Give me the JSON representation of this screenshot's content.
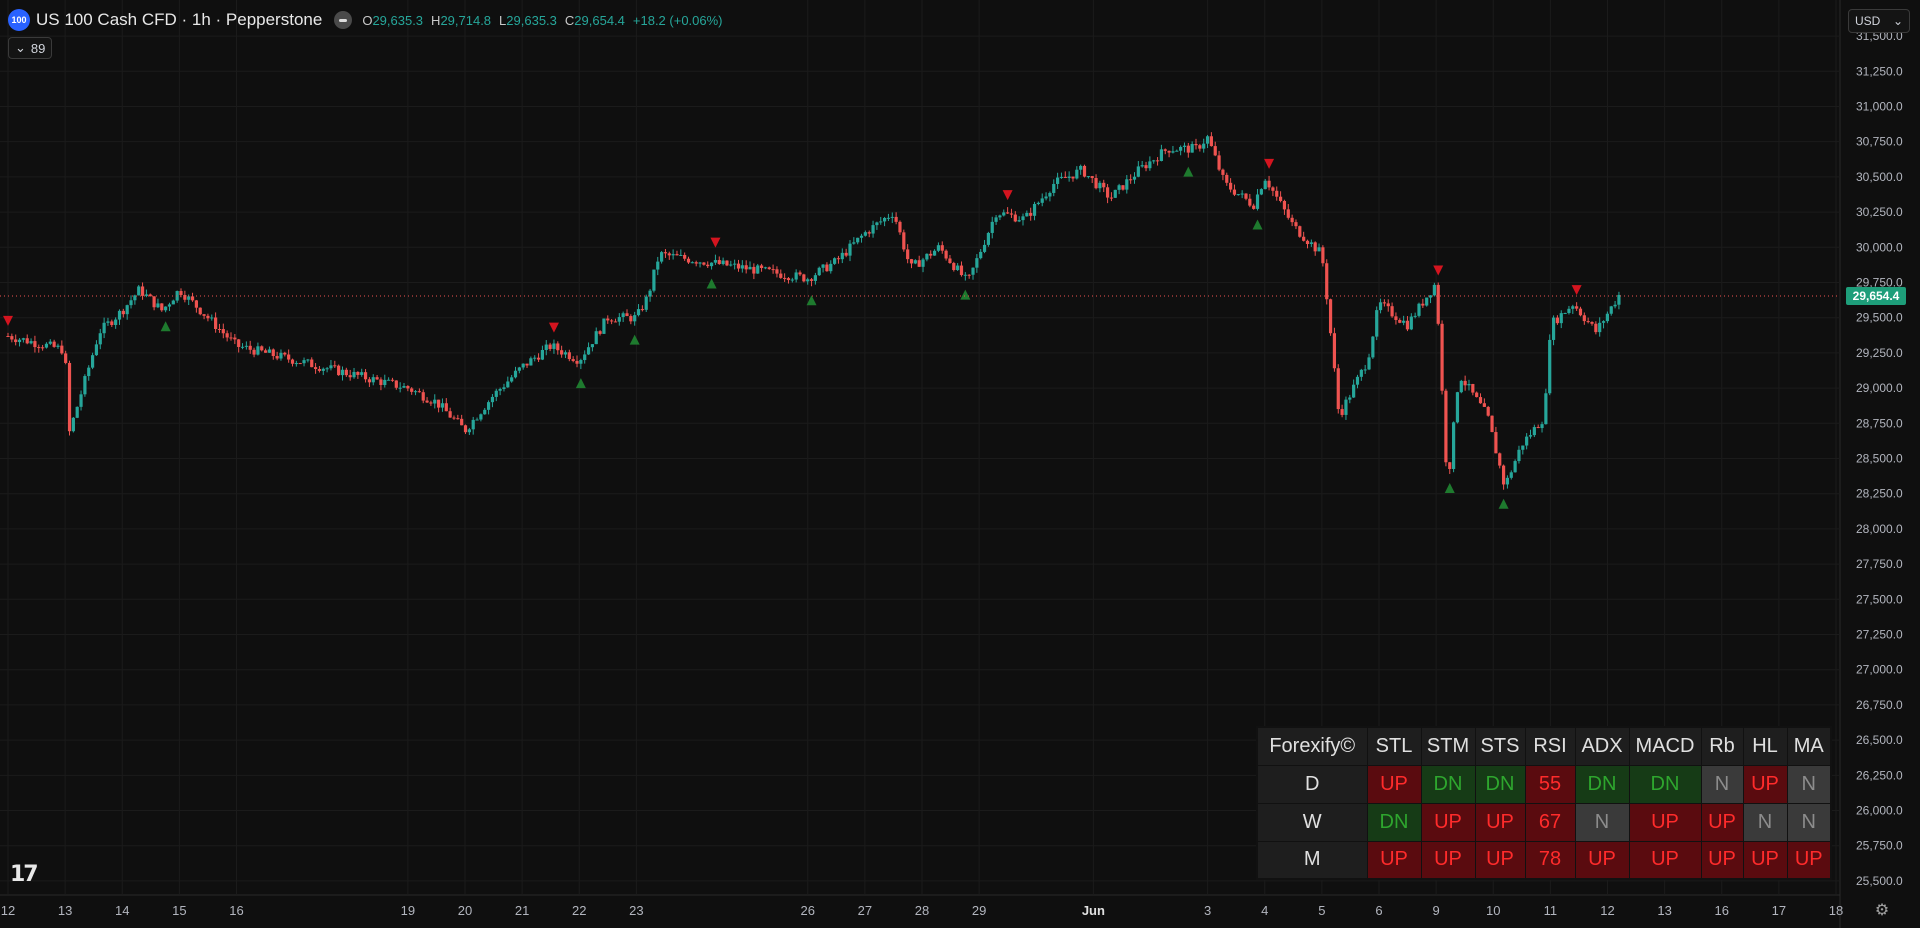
{
  "header": {
    "logo_text": "100",
    "title": "US 100 Cash CFD · 1h · Pepperstone",
    "ohlc": [
      {
        "label": "O",
        "value": "29,635.3"
      },
      {
        "label": "H",
        "value": "29,714.8"
      },
      {
        "label": "L",
        "value": "29,635.3"
      },
      {
        "label": "C",
        "value": "29,654.4"
      }
    ],
    "change": "+18.2 (+0.06%)",
    "collapse_count": "89"
  },
  "currency": "USD",
  "price_label": "29,654.4",
  "colors": {
    "up": "#26a69a",
    "down": "#ef5350",
    "background": "#0f0f0f",
    "price_badge": "#1e9e7a",
    "signal_up": "#1e7a2e",
    "signal_down": "#d4141f"
  },
  "chart_data": {
    "type": "candlestick",
    "y_ticks": [
      "31,500.0",
      "31,250.0",
      "31,000.0",
      "30,750.0",
      "30,500.0",
      "30,250.0",
      "30,000.0",
      "29,750.0",
      "29,500.0",
      "29,250.0",
      "29,000.0",
      "28,750.0",
      "28,500.0",
      "28,250.0",
      "28,000.0",
      "27,750.0",
      "27,500.0",
      "27,250.0",
      "27,000.0",
      "26,750.0",
      "26,500.0",
      "26,250.0",
      "26,000.0",
      "25,750.0",
      "25,500.0"
    ],
    "ylim": [
      25400,
      31600
    ],
    "current_price": 29654.4,
    "x_ticks": [
      "12",
      "13",
      "14",
      "15",
      "16",
      "19",
      "20",
      "21",
      "22",
      "23",
      "26",
      "27",
      "28",
      "29",
      "Jun",
      "3",
      "4",
      "5",
      "6",
      "9",
      "10",
      "11",
      "12",
      "13",
      "16",
      "17",
      "18"
    ],
    "path_points": [
      {
        "x": 12,
        "y": 29370
      },
      {
        "x": 13,
        "y": 29270
      },
      {
        "x": 13.05,
        "y": 28650
      },
      {
        "x": 13.6,
        "y": 29400
      },
      {
        "x": 14,
        "y": 29550
      },
      {
        "x": 14.3,
        "y": 29700
      },
      {
        "x": 14.7,
        "y": 29550
      },
      {
        "x": 15,
        "y": 29700
      },
      {
        "x": 15.5,
        "y": 29500
      },
      {
        "x": 16,
        "y": 29300
      },
      {
        "x": 16.5,
        "y": 29250
      },
      {
        "x": 19,
        "y": 29000
      },
      {
        "x": 19.5,
        "y": 28900
      },
      {
        "x": 20,
        "y": 28700
      },
      {
        "x": 20.5,
        "y": 28950
      },
      {
        "x": 21,
        "y": 29150
      },
      {
        "x": 21.5,
        "y": 29300
      },
      {
        "x": 22,
        "y": 29200
      },
      {
        "x": 22.5,
        "y": 29500
      },
      {
        "x": 23,
        "y": 29500
      },
      {
        "x": 23.2,
        "y": 29650
      },
      {
        "x": 23.4,
        "y": 29950
      },
      {
        "x": 26,
        "y": 29780
      },
      {
        "x": 26.5,
        "y": 29900
      },
      {
        "x": 27,
        "y": 30100
      },
      {
        "x": 27.5,
        "y": 30250
      },
      {
        "x": 27.8,
        "y": 29850
      },
      {
        "x": 28.3,
        "y": 30000
      },
      {
        "x": 28.8,
        "y": 29750
      },
      {
        "x": 29.3,
        "y": 30250
      },
      {
        "x": 29.8,
        "y": 30200
      },
      {
        "x": 30.3,
        "y": 30450
      },
      {
        "x": 30.8,
        "y": 30550
      },
      {
        "x": 31.3,
        "y": 30350
      },
      {
        "x": 31.8,
        "y": 30550
      },
      {
        "x": 32.3,
        "y": 30700
      },
      {
        "x": 32.8,
        "y": 30700
      },
      {
        "x": 33,
        "y": 30780
      },
      {
        "x": 33.3,
        "y": 30450
      },
      {
        "x": 33.8,
        "y": 30300
      },
      {
        "x": 34,
        "y": 30500
      },
      {
        "x": 34.5,
        "y": 30150
      },
      {
        "x": 35,
        "y": 29950
      },
      {
        "x": 35.1,
        "y": 29600
      },
      {
        "x": 35.3,
        "y": 28800
      },
      {
        "x": 35.8,
        "y": 29200
      },
      {
        "x": 36,
        "y": 29600
      },
      {
        "x": 36.5,
        "y": 29450
      },
      {
        "x": 37,
        "y": 29750
      },
      {
        "x": 37.1,
        "y": 29000
      },
      {
        "x": 37.2,
        "y": 28300
      },
      {
        "x": 37.4,
        "y": 29100
      },
      {
        "x": 37.9,
        "y": 28800
      },
      {
        "x": 38.2,
        "y": 28300
      },
      {
        "x": 38.5,
        "y": 28600
      },
      {
        "x": 38.9,
        "y": 28800
      },
      {
        "x": 39,
        "y": 29450
      },
      {
        "x": 39.4,
        "y": 29600
      },
      {
        "x": 39.8,
        "y": 29400
      },
      {
        "x": 40.2,
        "y": 29660
      }
    ],
    "x_positions": [
      12,
      13,
      14,
      15,
      16,
      19,
      20,
      21,
      22,
      23,
      26,
      27,
      28,
      29,
      31,
      33,
      34,
      35,
      36,
      37,
      38,
      39,
      40,
      41,
      42,
      43,
      44
    ]
  },
  "signal_table": {
    "title": "Forexify©",
    "columns": [
      "STL",
      "STM",
      "STS",
      "RSI",
      "ADX",
      "MACD",
      "Rb",
      "HL",
      "MA"
    ],
    "rows": [
      {
        "label": "D",
        "cells": [
          {
            "text": "UP",
            "state": "up"
          },
          {
            "text": "DN",
            "state": "dn"
          },
          {
            "text": "DN",
            "state": "dn"
          },
          {
            "text": "55",
            "state": "rsi"
          },
          {
            "text": "DN",
            "state": "dn"
          },
          {
            "text": "DN",
            "state": "dn"
          },
          {
            "text": "N",
            "state": "n"
          },
          {
            "text": "UP",
            "state": "up"
          },
          {
            "text": "N",
            "state": "n"
          }
        ]
      },
      {
        "label": "W",
        "cells": [
          {
            "text": "DN",
            "state": "dn"
          },
          {
            "text": "UP",
            "state": "up"
          },
          {
            "text": "UP",
            "state": "up"
          },
          {
            "text": "67",
            "state": "rsi"
          },
          {
            "text": "N",
            "state": "n"
          },
          {
            "text": "UP",
            "state": "up"
          },
          {
            "text": "UP",
            "state": "up"
          },
          {
            "text": "N",
            "state": "n"
          },
          {
            "text": "N",
            "state": "n"
          }
        ]
      },
      {
        "label": "M",
        "cells": [
          {
            "text": "UP",
            "state": "up"
          },
          {
            "text": "UP",
            "state": "up"
          },
          {
            "text": "UP",
            "state": "up"
          },
          {
            "text": "78",
            "state": "rsi"
          },
          {
            "text": "UP",
            "state": "up"
          },
          {
            "text": "UP",
            "state": "up"
          },
          {
            "text": "UP",
            "state": "up"
          },
          {
            "text": "UP",
            "state": "up"
          },
          {
            "text": "UP",
            "state": "up"
          }
        ]
      }
    ]
  },
  "icons": {
    "logo": "tradingview-logo",
    "settings": "gear-icon",
    "collapse": "chevron-down-icon"
  }
}
